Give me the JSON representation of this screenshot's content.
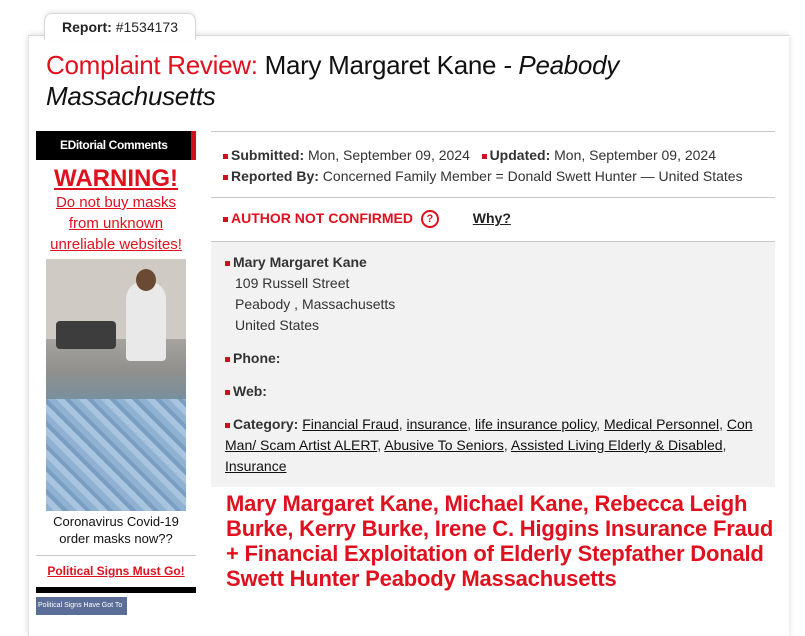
{
  "report_tab": {
    "label": "Report:",
    "number": "#1534173"
  },
  "title": {
    "prefix": "Complaint Review:",
    "name": "Mary Margaret Kane",
    "separator": " - ",
    "location": "Peabody Massachusetts"
  },
  "sidebar": {
    "editorial_header": "EDitorial Comments",
    "warning_title": "WARNING!",
    "warning_lines": [
      "Do not buy masks",
      "from unknown",
      "unreliable websites!"
    ],
    "photo_caption_lines": [
      "Coronavirus Covid-19",
      "order masks now??"
    ],
    "political_link": "Political Signs Must Go!",
    "political_thumb_text": "Political Signs Have Got To Go"
  },
  "meta": {
    "submitted_label": "Submitted:",
    "submitted_value": "Mon, September 09, 2024",
    "updated_label": "Updated:",
    "updated_value": "Mon, September 09, 2024",
    "reported_by_label": "Reported By:",
    "reported_by_value": "Concerned Family Member = Donald Swett Hunter — United States"
  },
  "author": {
    "status": "AUTHOR NOT CONFIRMED",
    "help_icon": "?",
    "why_link": "Why?"
  },
  "address": {
    "name": "Mary Margaret Kane",
    "street": "109 Russell Street",
    "city": "Peabody , Massachusetts",
    "country": "United States"
  },
  "details": {
    "phone_label": "Phone:",
    "web_label": "Web:",
    "category_label": "Category:",
    "categories": [
      "Financial Fraud",
      "insurance",
      "life insurance policy",
      "Medical Personnel",
      "Con Man/ Scam Artist ALERT",
      "Abusive To Seniors",
      "Assisted Living Elderly & Disabled",
      "Insurance"
    ]
  },
  "headline": "Mary Margaret Kane, Michael Kane, Rebecca Leigh Burke, Kerry Burke, Irene C. Higgins Insurance Fraud + Financial Exploitation of Elderly Stepfather Donald Swett Hunter Peabody Massachusetts",
  "colors": {
    "accent_red": "#e0101e",
    "header_black": "#000000",
    "panel_gray": "#f2f2f2"
  }
}
